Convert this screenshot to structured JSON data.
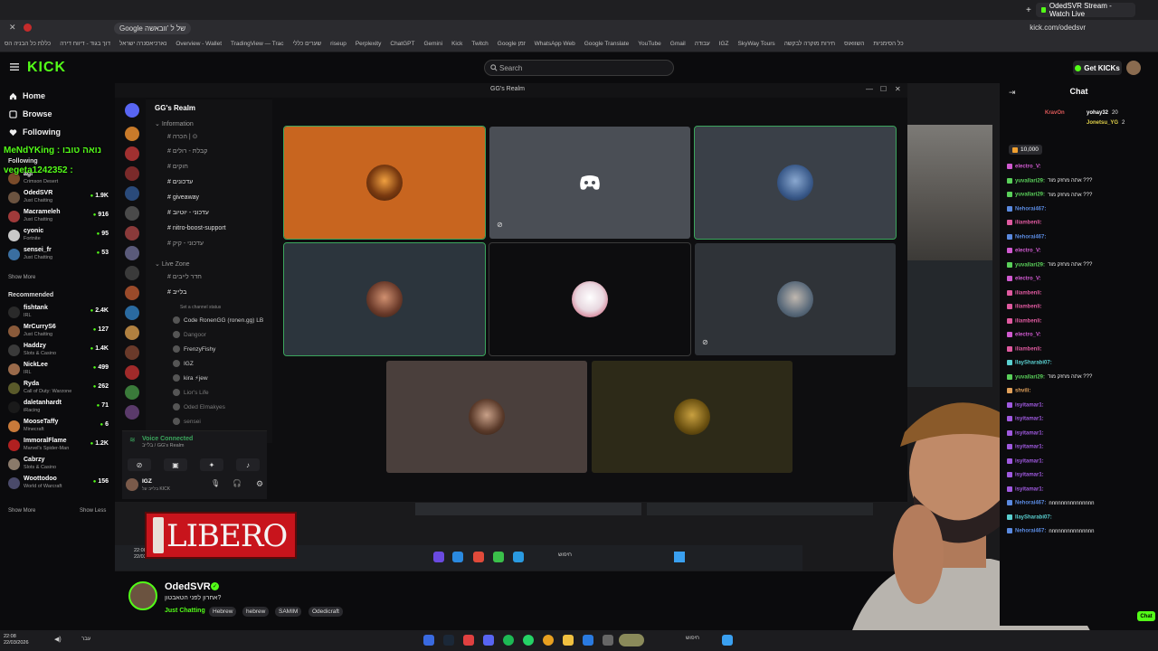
{
  "browser": {
    "tabs": [
      {
        "label": "OdedSVR Stream - Watch Live"
      }
    ],
    "omnibox_label": "Google של ל 'וובאשה",
    "url": "kick.com/odedsvr",
    "bookmarks": [
      "כללת כל הבניה הס",
      "דוך בגוד - דיווח דירה",
      "נארכיאסנרה ישראל",
      "Overview - Wallet",
      "TradingView — Trac",
      "שערים כללי",
      "riseup",
      "Perplexity",
      "ChatGPT",
      "Gemini",
      "Kick",
      "Twitch",
      "Google זמן",
      "WhatsApp Web",
      "Google Translate",
      "YouTube",
      "Gmail",
      "עבודה",
      "IGZ",
      "SkyWay Tours",
      "חירות מוקרה לבקשה",
      "השוואוס",
      "כל הסימניות"
    ]
  },
  "header": {
    "logo": "KICK",
    "search_placeholder": "Search",
    "get_kicks": "Get KICKs"
  },
  "sidebar": {
    "nav": [
      {
        "label": "Home",
        "icon": "home-icon"
      },
      {
        "label": "Browse",
        "icon": "browse-icon"
      },
      {
        "label": "Following",
        "icon": "heart-icon"
      }
    ],
    "following_heading": "Following",
    "following": [
      {
        "name": "agi",
        "category": "Crimson Desert",
        "viewers": "",
        "color": "#7a4b2a"
      },
      {
        "name": "OdedSVR",
        "category": "Just Chatting",
        "viewers": "1.9K",
        "color": "#6b5340"
      },
      {
        "name": "Macrameleh",
        "category": "Just Chatting",
        "viewers": "916",
        "color": "#a03a3a"
      },
      {
        "name": "cyonic",
        "category": "Fortnite",
        "viewers": "95",
        "color": "#c8c8c8"
      },
      {
        "name": "sensei_fr",
        "category": "Just Chatting",
        "viewers": "53",
        "color": "#3a6ea0"
      }
    ],
    "show_more": "Show More",
    "recommended_heading": "Recommended",
    "recommended": [
      {
        "name": "fishtank",
        "category": "IRL",
        "viewers": "2.4K",
        "color": "#2a2a2a"
      },
      {
        "name": "MrCurryS6",
        "category": "Just Chatting",
        "viewers": "127",
        "color": "#8a5a3a"
      },
      {
        "name": "Haddzy",
        "category": "Slots & Casino",
        "viewers": "1.4K",
        "color": "#3a3a3a"
      },
      {
        "name": "NickLee",
        "category": "IRL",
        "viewers": "499",
        "color": "#9a6a4a"
      },
      {
        "name": "Ryda",
        "category": "Call of Duty: Warzone",
        "viewers": "262",
        "color": "#5a5a2a"
      },
      {
        "name": "daletanhardt",
        "category": "iRacing",
        "viewers": "71",
        "color": "#1a1a1a"
      },
      {
        "name": "MooseTaffy",
        "category": "Minecraft",
        "viewers": "6",
        "color": "#c87a3a"
      },
      {
        "name": "ImmoralFlame",
        "category": "Marvel's Spider-Man",
        "viewers": "1.2K",
        "color": "#b02020"
      },
      {
        "name": "Cabrzy",
        "category": "Slots & Casino",
        "viewers": "",
        "color": "#8a7a6a"
      },
      {
        "name": "Woottodoo",
        "category": "World of Warcraft",
        "viewers": "156",
        "color": "#4a4a6a"
      }
    ],
    "show_more_2": "Show More",
    "show_less": "Show Less"
  },
  "overlay_chat": [
    {
      "text": "MeNdYKing : נואה טובו"
    },
    {
      "text": "vegeta1242352 :"
    }
  ],
  "discord": {
    "window_title": "GG's Realm",
    "server_name": "GG's Realm",
    "channels": [
      {
        "label": "Information",
        "dim": true
      },
      {
        "label": "הכרה | ⊙",
        "dim": true
      },
      {
        "label": "קבלת - רולים",
        "dim": true
      },
      {
        "label": "חוקים",
        "dim": true
      },
      {
        "label": "עדכונים",
        "dim": false
      },
      {
        "label": "giveaway",
        "dim": false
      },
      {
        "label": "עדכוני - יוטיוב",
        "dim": false
      },
      {
        "label": "nitro-boost-support",
        "dim": false
      },
      {
        "label": "עדכוני - קיק",
        "dim": true
      },
      {
        "label": "Live Zone",
        "dim": true
      },
      {
        "label": "חדר לייבים",
        "dim": true
      },
      {
        "label": "בלייב",
        "dim": false
      }
    ],
    "channel_status_hint": "Set a channel status",
    "voice_users": [
      {
        "name": "Code RonenGG (ronen.gg) LB",
        "dim": false
      },
      {
        "name": "Dangoor",
        "dim": true
      },
      {
        "name": "FrenzyFishy",
        "dim": false
      },
      {
        "name": "IGZ",
        "dim": false
      },
      {
        "name": "kira ⚡jew",
        "dim": false
      },
      {
        "name": "Lior's Life",
        "dim": true
      },
      {
        "name": "Oded Elmakyes",
        "dim": true
      },
      {
        "name": "sensei",
        "dim": true
      }
    ],
    "voice_connected": "Voice Connected",
    "voice_sub": "בלייב / GG's Realm",
    "me_name": "IGZ",
    "me_sub": "בלייב על KICK"
  },
  "taskbar_strip": {
    "time": "22:08",
    "date": "22/03/2026",
    "search": "חיפוש"
  },
  "sponsor": {
    "text": "LIBERO"
  },
  "chat": {
    "title": "Chat",
    "pinned": [
      {
        "user": "KravOn",
        "msg": "",
        "color": "#e05a5a"
      },
      {
        "user": "yohay32",
        "msg": "20",
        "color": "#ffffff"
      },
      {
        "user": "Jonetsu_YG",
        "msg": "2",
        "color": "#e0d04a"
      }
    ],
    "gift_amount": "10,000",
    "lines": [
      {
        "user": "electro_V:",
        "msg": "",
        "color": "#d05ad0"
      },
      {
        "user": "yuvallari29:",
        "msg": "אתה מחזק מוד ???",
        "color": "#5ad05a"
      },
      {
        "user": "yuvallari29:",
        "msg": "אתה מחזק מוד ???",
        "color": "#5ad05a"
      },
      {
        "user": "Nehorai467:",
        "msg": "",
        "color": "#5a8ae0"
      },
      {
        "user": "iliambenli:",
        "msg": "",
        "color": "#e05aa0"
      },
      {
        "user": "Nehorai467:",
        "msg": "",
        "color": "#5a8ae0"
      },
      {
        "user": "electro_V:",
        "msg": "",
        "color": "#d05ad0"
      },
      {
        "user": "yuvallari29:",
        "msg": "אתה מחזק מוד ???",
        "color": "#5ad05a"
      },
      {
        "user": "electro_V:",
        "msg": "",
        "color": "#d05ad0"
      },
      {
        "user": "iliambenli:",
        "msg": "",
        "color": "#e05aa0"
      },
      {
        "user": "iliambenli:",
        "msg": "",
        "color": "#e05aa0"
      },
      {
        "user": "iliambenli:",
        "msg": "",
        "color": "#e05aa0"
      },
      {
        "user": "electro_V:",
        "msg": "",
        "color": "#d05ad0"
      },
      {
        "user": "iliambenli:",
        "msg": "",
        "color": "#e05aa0"
      },
      {
        "user": "IlaySharabi07:",
        "msg": "",
        "color": "#5ad0d0"
      },
      {
        "user": "yuvallari29:",
        "msg": "אתה מחזק מוד ???",
        "color": "#5ad05a"
      },
      {
        "user": "shvili:",
        "msg": "",
        "color": "#e0a05a"
      },
      {
        "user": "isyitamar1:",
        "msg": "",
        "color": "#a05ae0"
      },
      {
        "user": "isyitamar1:",
        "msg": "",
        "color": "#a05ae0"
      },
      {
        "user": "isyitamar1:",
        "msg": "",
        "color": "#a05ae0"
      },
      {
        "user": "isyitamar1:",
        "msg": "",
        "color": "#a05ae0"
      },
      {
        "user": "isyitamar1:",
        "msg": "",
        "color": "#a05ae0"
      },
      {
        "user": "isyitamar1:",
        "msg": "",
        "color": "#a05ae0"
      },
      {
        "user": "isyitamar1:",
        "msg": "",
        "color": "#a05ae0"
      },
      {
        "user": "Nehorai467:",
        "msg": "nnnnnnnnnnnnnnn",
        "color": "#5a8ae0"
      },
      {
        "user": "IlaySharabi07:",
        "msg": "",
        "color": "#5ad0d0"
      },
      {
        "user": "Nehorai467:",
        "msg": "nnnnnnnnnnnnnnn",
        "color": "#5a8ae0"
      }
    ],
    "chat_button": "Chat"
  },
  "stream_info": {
    "streamer": "OdedSVR",
    "title": "אחרון לפני הטאבטון?",
    "category": "Just Chatting",
    "tags": [
      "Hebrew",
      "hebrew",
      "SAMIM",
      "Odedicraft"
    ]
  },
  "os_taskbar": {
    "time": "22:08",
    "date": "22/03/2026",
    "lang": "עבר",
    "search": "חיפוש"
  },
  "colors": {
    "kick_green": "#53fc18",
    "discord_speaking": "#3ba55d",
    "orange_tile": "#c8651f"
  }
}
